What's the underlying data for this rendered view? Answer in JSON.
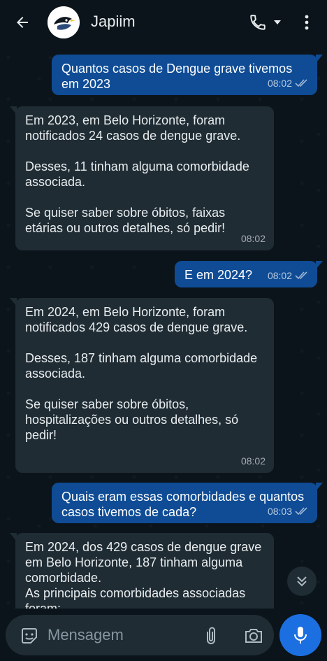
{
  "header": {
    "title": "Japiim",
    "back_icon": "arrow-left-icon",
    "avatar_icon": "bird-avatar",
    "call_icon": "phone-icon",
    "dropdown_icon": "caret-down-icon",
    "more_icon": "more-vertical-icon"
  },
  "messages": [
    {
      "direction": "out",
      "text": "Quantos casos de Dengue grave tivemos em 2023",
      "time": "08:02",
      "status": "read"
    },
    {
      "direction": "in",
      "text": "Em 2023, em Belo Horizonte, foram notificados 24 casos de dengue grave.\n\nDesses, 11 tinham alguma comorbidade associada.\n\nSe quiser saber sobre óbitos, faixas etárias ou outros detalhes, só pedir!",
      "time": "08:02"
    },
    {
      "direction": "out",
      "text": "E em 2024?",
      "time": "08:02",
      "status": "read"
    },
    {
      "direction": "in",
      "text": "Em 2024, em Belo Horizonte, foram notificados 429 casos de dengue grave.\n\nDesses, 187 tinham alguma comorbidade associada.\n\nSe quiser saber sobre óbitos, hospitalizações ou outros detalhes, só pedir!",
      "time": "08:02"
    },
    {
      "direction": "out",
      "text": "Quais eram essas comorbidades e quantos casos tivemos de cada?",
      "time": "08:03",
      "status": "read"
    },
    {
      "direction": "in",
      "text": "Em 2024, dos 429 casos de dengue grave em Belo Horizonte, 187 tinham alguma comorbidade.\nAs principais comorbidades associadas foram:",
      "time": ""
    }
  ],
  "input": {
    "placeholder": "Mensagem",
    "emoji_icon": "sticker-icon",
    "attach_icon": "paperclip-icon",
    "camera_icon": "camera-icon",
    "mic_icon": "microphone-icon"
  },
  "scroll_icon": "double-chevron-down-icon",
  "colors": {
    "background": "#0b141a",
    "outgoing_bubble": "#0f4c95",
    "incoming_bubble": "#1f2c34",
    "accent": "#1c6fe0",
    "read_ticks": "#8696a0"
  }
}
